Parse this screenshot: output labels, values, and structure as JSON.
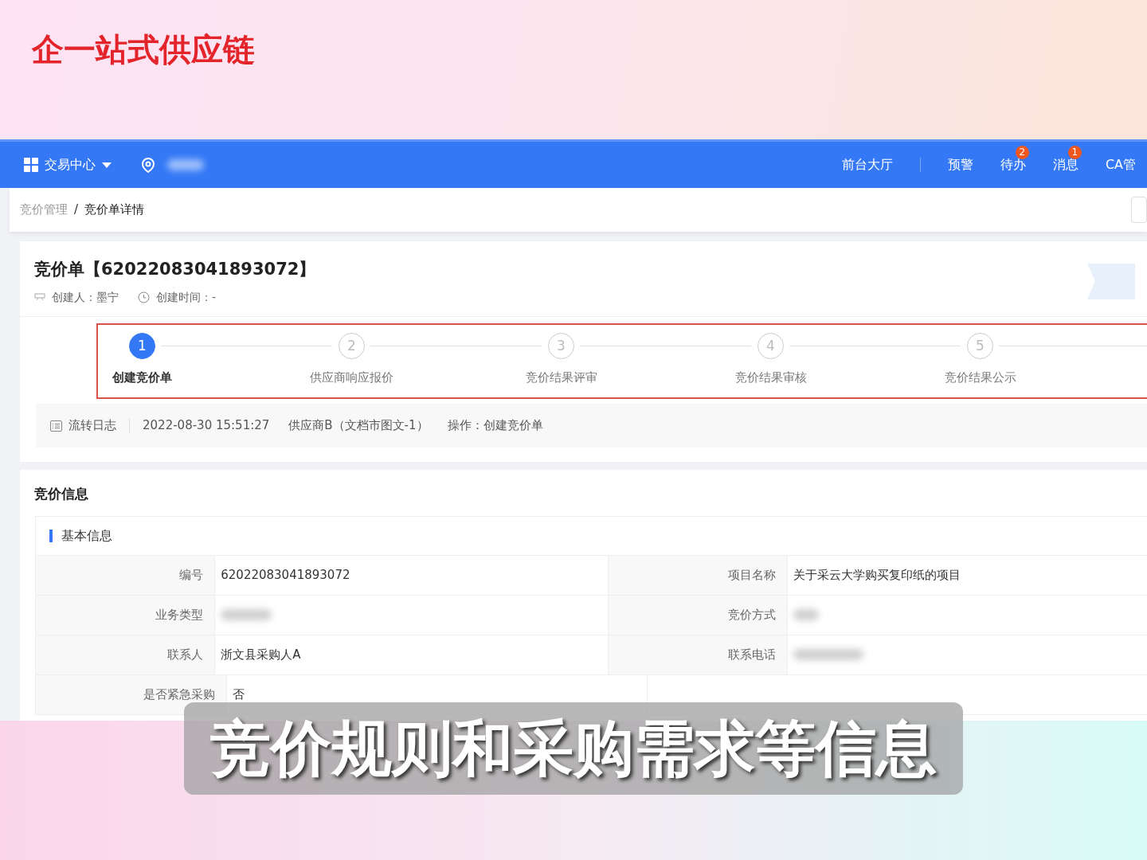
{
  "video_title": "企一站式供应链",
  "navbar": {
    "menu": "交易中心",
    "front_link": "前台大厅",
    "links": [
      {
        "label": "预警"
      },
      {
        "label": "待办",
        "badge": "2"
      },
      {
        "label": "消息",
        "badge": "1"
      },
      {
        "label": "CA管"
      }
    ]
  },
  "breadcrumb": [
    {
      "label": "竞价管理",
      "current": false
    },
    {
      "label": "竞价单详情",
      "current": true
    }
  ],
  "breadcrumb_separator": "/",
  "order": {
    "title": "竞价单【62022083041893072】",
    "creator": "创建人：墨宁",
    "created_time": "创建时间：-"
  },
  "steps": [
    {
      "number": "1",
      "label": "创建竞价单",
      "active": true
    },
    {
      "number": "2",
      "label": "供应商响应报价",
      "active": false
    },
    {
      "number": "3",
      "label": "竞价结果评审",
      "active": false
    },
    {
      "number": "4",
      "label": "竞价结果审核",
      "active": false
    },
    {
      "number": "5",
      "label": "竞价结果公示",
      "active": false
    }
  ],
  "log": {
    "label": "流转日志",
    "time": "2022-08-30 15:51:27",
    "actor": "供应商B（文档市图文-1）",
    "action": "操作：创建竞价单"
  },
  "section": {
    "title": "竞价信息",
    "subsection": "基本信息",
    "rows": [
      [
        {
          "label": "编号",
          "value": "62022083041893072",
          "redacted": false
        },
        {
          "label": "项目名称",
          "value": "关于采云大学购买复印纸的项目",
          "redacted": false
        }
      ],
      [
        {
          "label": "业务类型",
          "redacted": true
        },
        {
          "label": "竞价方式",
          "redacted": true
        }
      ],
      [
        {
          "label": "联系人",
          "value": "浙文县采购人A",
          "redacted": false
        },
        {
          "label": "联系电话",
          "redacted": true
        }
      ],
      [
        {
          "label": "是否紧急采购",
          "value": "否",
          "redacted": false
        }
      ]
    ]
  },
  "caption": "竞价规则和采购需求等信息"
}
